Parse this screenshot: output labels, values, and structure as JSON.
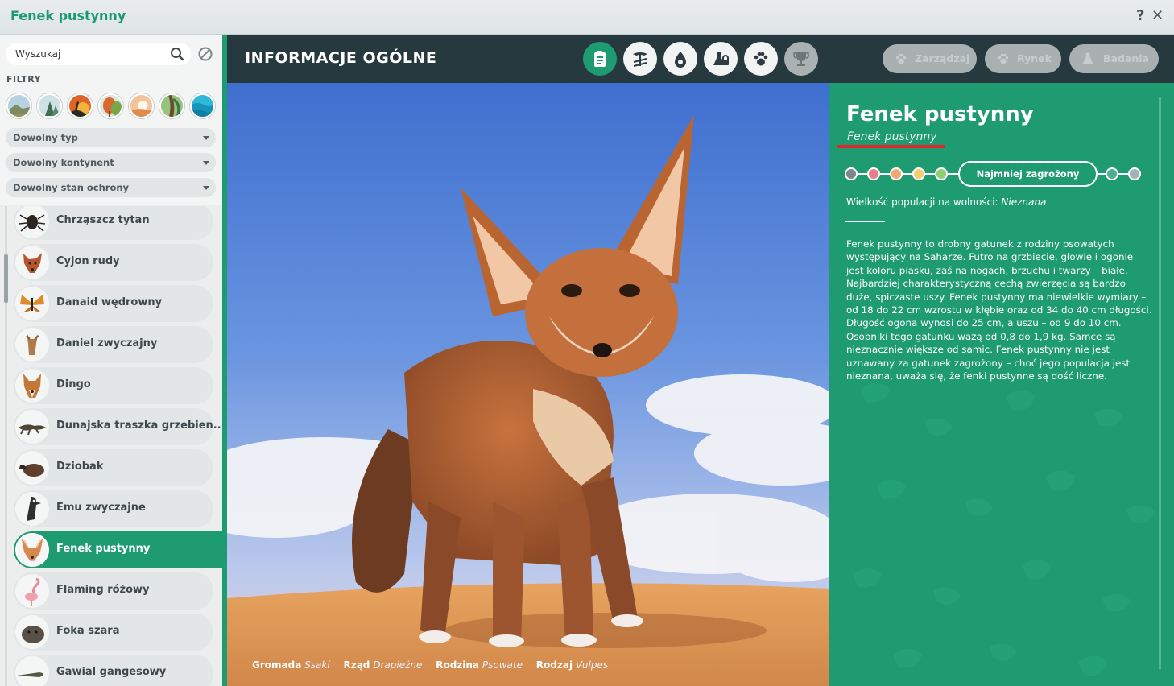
{
  "window": {
    "title": "Fenek pustynny",
    "help_label": "?",
    "close_label": "✕"
  },
  "search": {
    "placeholder": "Wyszukaj"
  },
  "filters": {
    "label": "FILTRY",
    "biomes": [
      "grassland-icon",
      "taiga-icon",
      "tropical-icon",
      "temperate-icon",
      "desert-icon",
      "jungle-icon",
      "aquatic-icon"
    ],
    "dropdowns": [
      "Dowolny typ",
      "Dowolny kontynent",
      "Dowolny stan ochrony"
    ]
  },
  "animals": [
    {
      "name": "Chrząszcz tytan",
      "icon": "beetle-icon"
    },
    {
      "name": "Cyjon rudy",
      "icon": "dhole-icon"
    },
    {
      "name": "Danaid wędrowny",
      "icon": "butterfly-icon"
    },
    {
      "name": "Daniel zwyczajny",
      "icon": "deer-icon"
    },
    {
      "name": "Dingo",
      "icon": "dingo-icon"
    },
    {
      "name": "Dunajska traszka grzebien...",
      "icon": "newt-icon"
    },
    {
      "name": "Dziobak",
      "icon": "platypus-icon"
    },
    {
      "name": "Emu zwyczajne",
      "icon": "emu-icon"
    },
    {
      "name": "Fenek pustynny",
      "icon": "fennec-icon",
      "selected": true
    },
    {
      "name": "Flaming różowy",
      "icon": "flamingo-icon"
    },
    {
      "name": "Foka szara",
      "icon": "seal-icon"
    },
    {
      "name": "Gawial gangesowy",
      "icon": "gharial-icon"
    }
  ],
  "header": {
    "title": "INFORMACJE OGÓLNE",
    "tabs": [
      "clipboard-icon",
      "habitat-icon",
      "food-icon",
      "enrichment-icon",
      "paw-icon",
      "trophy-icon"
    ],
    "buttons": [
      "Zarządzaj",
      "Rynek",
      "Badania"
    ]
  },
  "taxonomy": [
    {
      "key": "Gromada",
      "value": "Ssaki"
    },
    {
      "key": "Rząd",
      "value": "Drapieżne"
    },
    {
      "key": "Rodzina",
      "value": "Psowate"
    },
    {
      "key": "Rodzaj",
      "value": "Vulpes"
    }
  ],
  "info": {
    "name": "Fenek pustynny",
    "latin": "Fenek pustynny",
    "status": "Najmniej zagrożony",
    "status_colors": [
      "#7b878a",
      "#e77f8a",
      "#f2a86f",
      "#f0cf6c",
      "#8fcf73",
      "#4bb08b",
      "#9fb4b8"
    ],
    "population_label": "Wielkość populacji na wolności:",
    "population_value": "Nieznana",
    "description": "Fenek pustynny to drobny gatunek z rodziny psowatych występujący na Saharze. Futro na grzbiecie, głowie i ogonie jest koloru piasku, zaś na nogach, brzuchu i twarzy – białe. Najbardziej charakterystyczną cechą zwierzęcia są bardzo duże, spiczaste uszy. Fenek pustynny ma niewielkie wymiary – od 18 do 22 cm wzrostu w kłębie oraz od 34 do 40 cm długości. Długość ogona wynosi do 25 cm, a uszu – od 9 do 10 cm. Osobniki tego gatunku ważą od 0,8 do 1,9 kg. Samce są nieznacznie większe od samic. Fenek pustynny nie jest uznawany za gatunek zagrożony – choć jego populacja jest nieznana, uważa się, że fenki pustynne są dość liczne."
  },
  "colors": {
    "accent": "#1f9b72",
    "header": "#25393f",
    "redline": "#e0272d"
  }
}
